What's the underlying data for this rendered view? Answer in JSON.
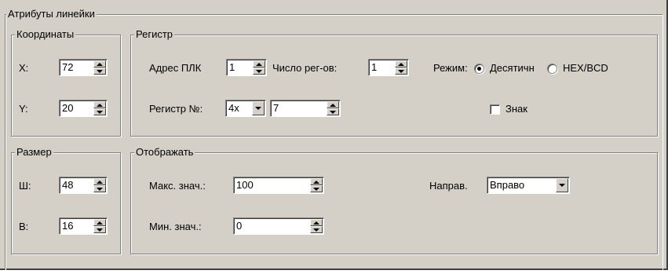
{
  "title": "Атрибуты линейки",
  "coords": {
    "legend": "Координаты",
    "x_label": "X:",
    "x_value": "72",
    "y_label": "Y:",
    "y_value": "20"
  },
  "register": {
    "legend": "Регистр",
    "plc_label": "Адрес ПЛК",
    "plc_value": "1",
    "count_label": "Число рег-ов:",
    "count_value": "1",
    "mode_label": "Режим:",
    "mode_decimal": "Десятичн",
    "mode_hex": "HEX/BCD",
    "mode_selected": "decimal",
    "reg_label": "Регистр №:",
    "reg_type": "4x",
    "reg_value": "7",
    "sign_label": "Знак",
    "sign_checked": false
  },
  "size": {
    "legend": "Размер",
    "w_label": "Ш:",
    "w_value": "48",
    "h_label": "В:",
    "h_value": "16"
  },
  "display": {
    "legend": "Отображать",
    "max_label": "Макс. знач.:",
    "max_value": "100",
    "min_label": "Мин. знач.:",
    "min_value": "0",
    "dir_label": "Направ.",
    "dir_value": "Вправо"
  },
  "icons": {
    "spin_up": "spin-up-arrow-icon",
    "spin_down": "spin-down-arrow-icon",
    "dropdown": "chevron-down-icon"
  }
}
